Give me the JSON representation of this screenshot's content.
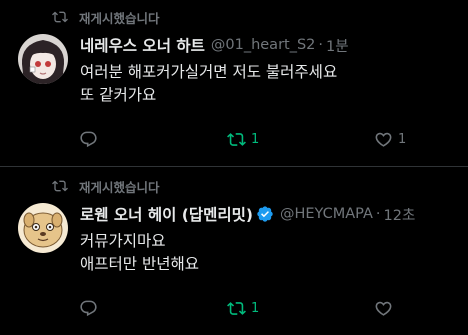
{
  "tweets": [
    {
      "retweet_context": "재게시했습니다",
      "display_name": "네레우스 오너 하트",
      "verified": false,
      "handle": "@01_heart_S2",
      "separator": "·",
      "time": "1분",
      "text_lines": [
        "여러분 해포커가실거면 저도 불러주세요",
        "또 같커가요"
      ],
      "reply_count": "",
      "retweet_count": "1",
      "like_count": "1",
      "retweeted": true,
      "liked": false
    },
    {
      "retweet_context": "재게시했습니다",
      "display_name": "로웬 오너 헤이 (답멘리밋)",
      "verified": true,
      "handle": "@HEYCMAPA",
      "separator": "·",
      "time": "12초",
      "text_lines": [
        "커뮤가지마요",
        "애프터만 반년해요"
      ],
      "reply_count": "",
      "retweet_count": "1",
      "like_count": "",
      "retweeted": true,
      "liked": false
    }
  ],
  "colors": {
    "background": "#000000",
    "text_primary": "#e7e9ea",
    "text_secondary": "#71767b",
    "retweet_active": "#00ba7c",
    "verified_badge": "#1d9bf0",
    "divider": "#2f3336"
  },
  "icons": {
    "retweet_context": "retweet-icon",
    "verified": "verified-badge-icon",
    "reply": "reply-icon",
    "retweet": "retweet-icon",
    "like": "heart-icon"
  }
}
